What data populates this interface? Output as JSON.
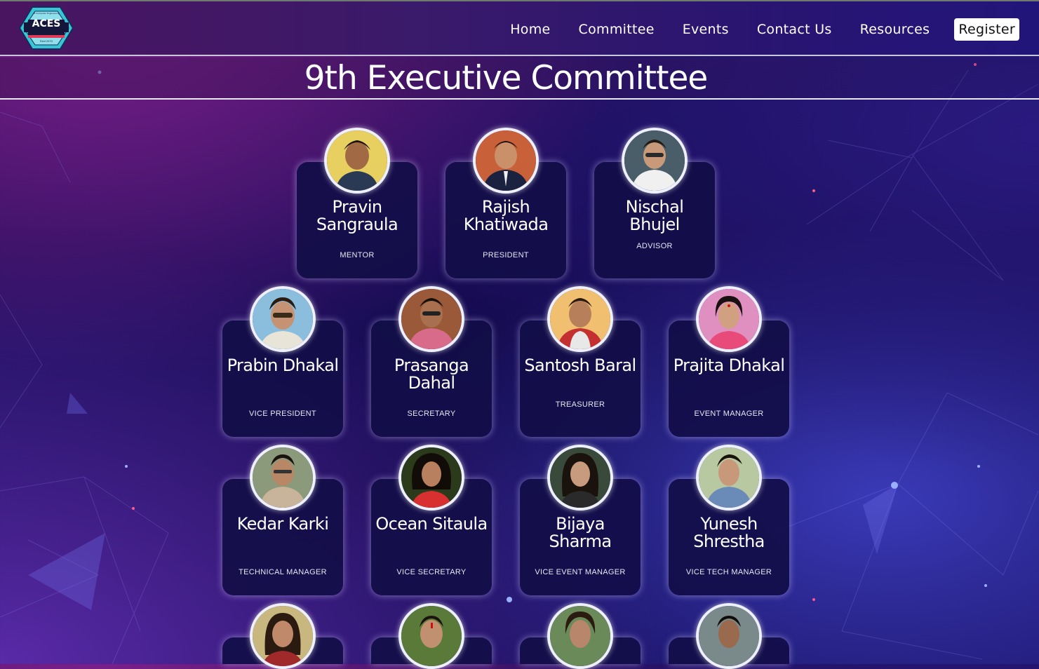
{
  "nav": {
    "logo_text": "ACES",
    "logo_small_text": "of Computer Engineering",
    "logo_est": "Estd 2070",
    "links": [
      "Home",
      "Committee",
      "Events",
      "Contact Us",
      "Resources"
    ],
    "register": "Register"
  },
  "page": {
    "title": "9th Executive Committee"
  },
  "members": [
    {
      "name": "Pravin Sangraula",
      "role": "MENTOR"
    },
    {
      "name": "Rajish Khatiwada",
      "role": "PRESIDENT"
    },
    {
      "name": "Nischal Bhujel",
      "role": "ADVISOR"
    },
    {
      "name": "Prabin Dhakal",
      "role": "VICE PRESIDENT"
    },
    {
      "name": "Prasanga Dahal",
      "role": "SECRETARY"
    },
    {
      "name": "Santosh Baral",
      "role": "TREASURER"
    },
    {
      "name": "Prajita Dhakal",
      "role": "EVENT MANAGER"
    },
    {
      "name": "Kedar Karki",
      "role": "TECHNICAL MANAGER"
    },
    {
      "name": "Ocean Sitaula",
      "role": "VICE SECRETARY"
    },
    {
      "name": "Bijaya Sharma",
      "role": "VICE EVENT MANAGER"
    },
    {
      "name": "Yunesh Shrestha",
      "role": "VICE TECH MANAGER"
    },
    {
      "name": "",
      "role": ""
    },
    {
      "name": "",
      "role": ""
    },
    {
      "name": "",
      "role": ""
    },
    {
      "name": "",
      "role": ""
    }
  ],
  "colors": {
    "accent": "#1e0f5a",
    "card_glow": "#d2c8ff",
    "logo_teal": "#38c6d6"
  }
}
